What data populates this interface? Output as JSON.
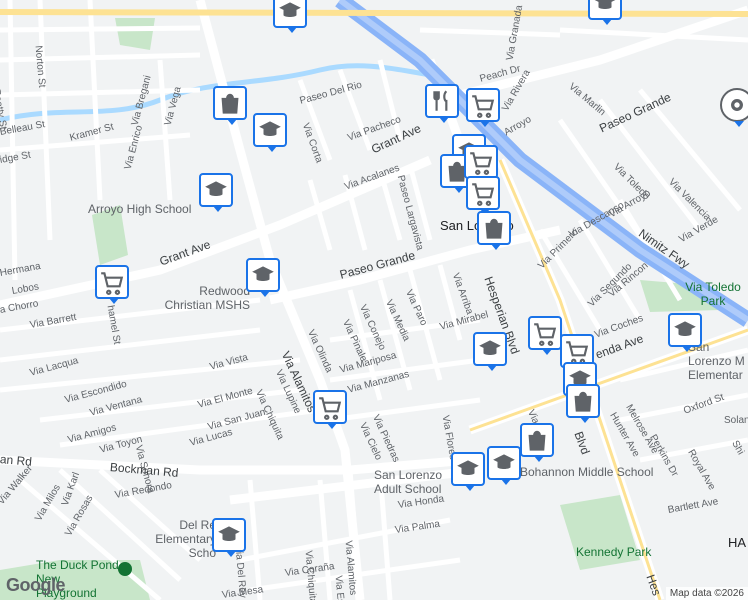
{
  "map": {
    "attribution": "Map data ©2026",
    "logo_text": "Google",
    "labels": {
      "norton": "Norton St",
      "beatty": "Beatty St",
      "belleau": "Belleau St",
      "kramer": "Kramer St",
      "bridge": "idge St",
      "via_bregani": "Via Bregani",
      "via_vega": "Via Vega",
      "via_enrico": "Via Enrico",
      "paseo_del_rio": "Paseo Del Rio",
      "via_corta": "Via Corta",
      "via_pacheco": "Via Pacheco",
      "grant_ave_top": "Grant Ave",
      "grant_ave_left": "Grant Ave",
      "via_acalanes": "Via Acalanes",
      "arroyo_high": "Arroyo High School",
      "redwood_christian": "Redwood Christian MSHS",
      "via_granada": "Via Granada",
      "peach_dr": "Peach Dr",
      "via_rivera": "Via Rivera",
      "arroyo": "Arroyo",
      "via_marlin": "Via Marlin",
      "paseo_grande_ne": "Paseo Grande",
      "via_toledo": "Via Toledo",
      "via_valencia": "Via Valencia",
      "via_arroyo": "Via Arroyo",
      "via_verde": "Via Verde",
      "nimitz": "Nimitz Fwy",
      "via_descanso": "Via Descanso",
      "via_toledo_park": "Via Toledo Park",
      "paseo_largavista": "Paseo Largavista",
      "san_lorenzo": "San Lorenzo",
      "paseo_grande_mid": "Paseo Grande",
      "via_arriba": "Via Arriba",
      "hesperian": "Hesperian Blvd",
      "via_primero": "Via Primero",
      "via_rincon": "Via Rincon",
      "via_segundo": "Via Segundo",
      "via_coches": "Via Coches",
      "hermana": "Hermana",
      "lobos": "Lobos",
      "chorro": "a Chorro",
      "barrett": "Via Barrett",
      "via_lacqua": "Via Lacqua",
      "shamel": "hamel St",
      "via_conejo": "Via Conejo",
      "via_media": "Via Media",
      "via_paro": "Via Paro",
      "via_pinale": "Via Pinale",
      "via_olinda": "Via Olinda",
      "via_alamitos": "Via Alamitos",
      "via_mirabel": "Via Mirabel",
      "via_vista": "Via Vista",
      "via_escondido": "Via Escondido",
      "via_ventana": "Via Ventana",
      "via_el_monte": "Via El Monte",
      "via_lupine": "Via Lupine",
      "via_mariposa": "Via Mariposa",
      "via_manzanas": "Via Manzanas",
      "via_amigos": "Via Amigos",
      "via_san_juan": "Via San Juan",
      "via_chiquita": "Via Chiquita",
      "via_toyon": "Via Toyon",
      "via_sonora": "Via Sonora",
      "via_lucas": "Via Lucas",
      "via_cielo": "Via Cielo",
      "via_piedras": "Via Piedras",
      "via_flores": "Via Flores",
      "enda_ave": "enda Ave",
      "melrose_ave": "Melrose Ave",
      "hunter_ave": "Hunter Ave",
      "perkins_dr": "Perkins Dr",
      "oxford_st": "Oxford St",
      "royal_ave": "Royal Ave",
      "solano": "Solano",
      "shi": "Shi",
      "san_lorenzo_elem": "San Lorenzo M Elementar",
      "bockman_left": "an Rd",
      "bockman": "Bockman Rd",
      "via_walker": "Via Walker",
      "via_karl": "Via Karl",
      "via_redondo": "Via Redondo",
      "via_milos": "Via Milos",
      "via_rosas": "Via Rosas",
      "slz_adult": "San Lorenzo Adult School",
      "bohannon": "Bohannon Middle School",
      "via_honda": "Via Honda",
      "via_palma": "Via Palma",
      "del_rey_elem": "Del Re Elementary Scho",
      "via_del_rey": "Via Del Rey",
      "via_chiquita_s": "Via Chiquita",
      "via_alamitos_s": "Via Alamitos",
      "via_estrella": "Via Estrella",
      "via_corona": "Via Coraña",
      "via_mesa": "Via Mesa",
      "duck_pond": "The Duck Pond New Playground SLCCP",
      "kennedy_park": "Kennedy Park",
      "bartlett": "Bartlett Ave",
      "ha": "HA",
      "hes_s": "Hes",
      "blvd_s": "Blvd",
      "via_arriba_s": "Via Arriba"
    },
    "markers": [
      {
        "kind": "school"
      },
      {
        "kind": "school"
      },
      {
        "kind": "shopping"
      },
      {
        "kind": "school"
      },
      {
        "kind": "school"
      },
      {
        "kind": "restaurant"
      },
      {
        "kind": "grocery"
      },
      {
        "kind": "school"
      },
      {
        "kind": "shopping"
      },
      {
        "kind": "grocery"
      },
      {
        "kind": "grocery"
      },
      {
        "kind": "shopping"
      },
      {
        "kind": "school"
      },
      {
        "kind": "grocery"
      },
      {
        "kind": "school"
      },
      {
        "kind": "grocery"
      },
      {
        "kind": "grocery"
      },
      {
        "kind": "school"
      },
      {
        "kind": "school"
      },
      {
        "kind": "shopping"
      },
      {
        "kind": "grocery"
      },
      {
        "kind": "shopping"
      },
      {
        "kind": "school"
      },
      {
        "kind": "school"
      },
      {
        "kind": "shopping"
      },
      {
        "kind": "school"
      },
      {
        "kind": "school"
      },
      {
        "kind": "settings"
      }
    ],
    "colors": {
      "background": "#f1f3f4",
      "road": "#ffffff",
      "arterial": "#fde293",
      "freeway": "#8ab4f8",
      "water": "#aadaff",
      "park": "#c8e6c9",
      "marker_border": "#1a73e8"
    }
  }
}
